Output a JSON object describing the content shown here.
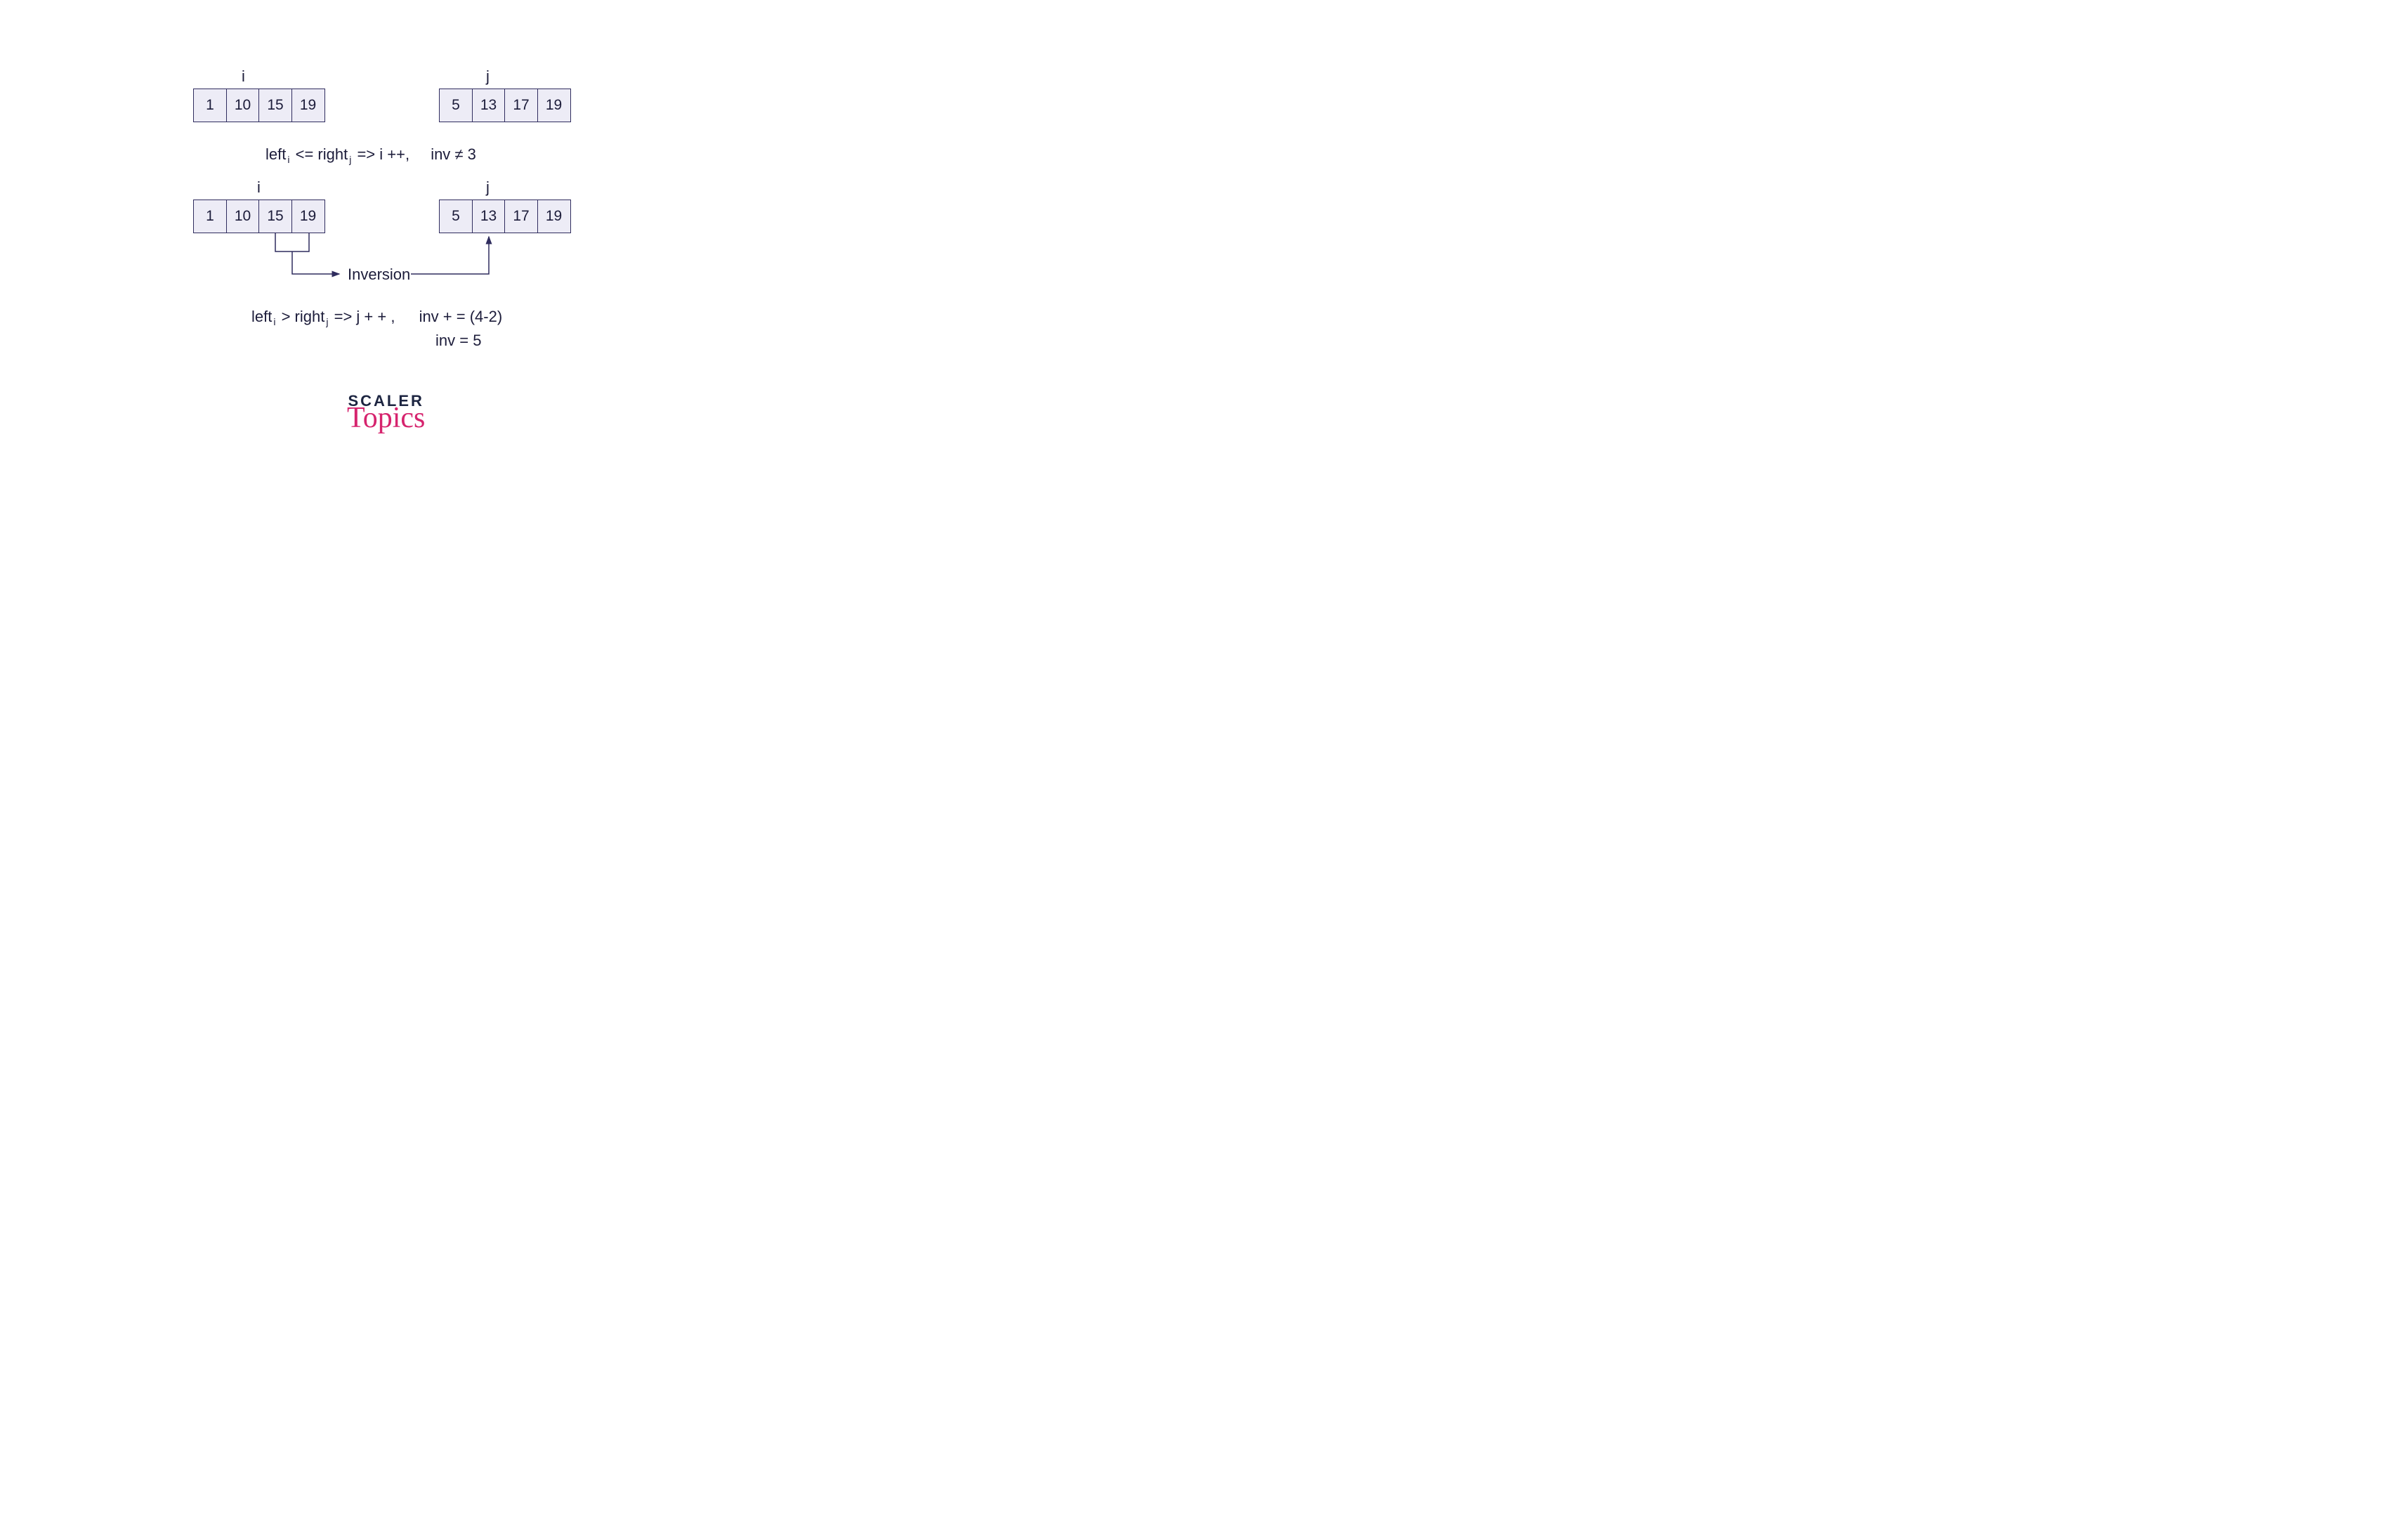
{
  "pointers": {
    "i": "i",
    "j": "j"
  },
  "arrays": {
    "left1": [
      "1",
      "10",
      "15",
      "19"
    ],
    "right1": [
      "5",
      "13",
      "17",
      "19"
    ],
    "left2": [
      "1",
      "10",
      "15",
      "19"
    ],
    "right2": [
      "5",
      "13",
      "17",
      "19"
    ]
  },
  "formulas": {
    "line1_left": "left",
    "line1_sub1": "i",
    "line1_mid1": " <= right",
    "line1_sub2": "j",
    "line1_mid2": "   =>  i ++,",
    "line1_inv": "inv ≠ 3",
    "line2_left": "left",
    "line2_sub1": "i",
    "line2_mid1": " > right",
    "line2_sub2": "j",
    "line2_mid2": "   =>  j + + ,",
    "line2_inv1": "inv + = (4-2)",
    "line2_inv2": "inv = 5"
  },
  "inversion_label": "Inversion",
  "logo": {
    "scaler": "SCALER",
    "topics": "Topics"
  }
}
